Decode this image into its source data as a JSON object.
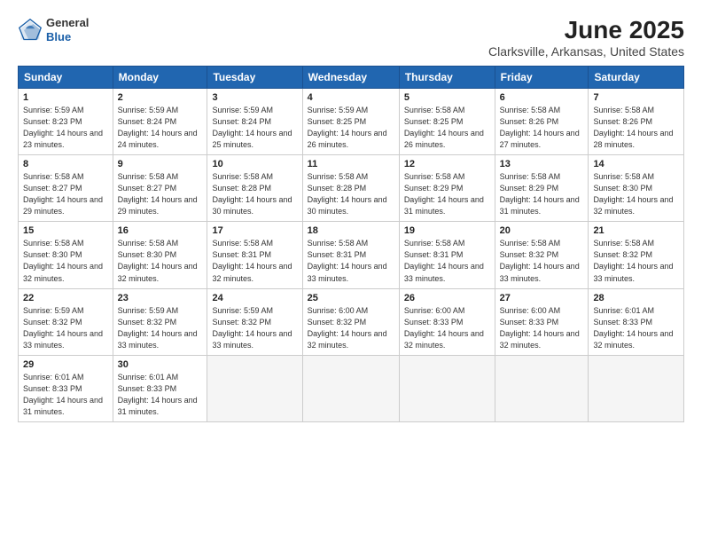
{
  "logo": {
    "general": "General",
    "blue": "Blue"
  },
  "title": "June 2025",
  "subtitle": "Clarksville, Arkansas, United States",
  "days_of_week": [
    "Sunday",
    "Monday",
    "Tuesday",
    "Wednesday",
    "Thursday",
    "Friday",
    "Saturday"
  ],
  "weeks": [
    [
      {
        "day": 1,
        "sunrise": "5:59 AM",
        "sunset": "8:23 PM",
        "daylight": "14 hours and 23 minutes."
      },
      {
        "day": 2,
        "sunrise": "5:59 AM",
        "sunset": "8:24 PM",
        "daylight": "14 hours and 24 minutes."
      },
      {
        "day": 3,
        "sunrise": "5:59 AM",
        "sunset": "8:24 PM",
        "daylight": "14 hours and 25 minutes."
      },
      {
        "day": 4,
        "sunrise": "5:59 AM",
        "sunset": "8:25 PM",
        "daylight": "14 hours and 26 minutes."
      },
      {
        "day": 5,
        "sunrise": "5:58 AM",
        "sunset": "8:25 PM",
        "daylight": "14 hours and 26 minutes."
      },
      {
        "day": 6,
        "sunrise": "5:58 AM",
        "sunset": "8:26 PM",
        "daylight": "14 hours and 27 minutes."
      },
      {
        "day": 7,
        "sunrise": "5:58 AM",
        "sunset": "8:26 PM",
        "daylight": "14 hours and 28 minutes."
      }
    ],
    [
      {
        "day": 8,
        "sunrise": "5:58 AM",
        "sunset": "8:27 PM",
        "daylight": "14 hours and 29 minutes."
      },
      {
        "day": 9,
        "sunrise": "5:58 AM",
        "sunset": "8:27 PM",
        "daylight": "14 hours and 29 minutes."
      },
      {
        "day": 10,
        "sunrise": "5:58 AM",
        "sunset": "8:28 PM",
        "daylight": "14 hours and 30 minutes."
      },
      {
        "day": 11,
        "sunrise": "5:58 AM",
        "sunset": "8:28 PM",
        "daylight": "14 hours and 30 minutes."
      },
      {
        "day": 12,
        "sunrise": "5:58 AM",
        "sunset": "8:29 PM",
        "daylight": "14 hours and 31 minutes."
      },
      {
        "day": 13,
        "sunrise": "5:58 AM",
        "sunset": "8:29 PM",
        "daylight": "14 hours and 31 minutes."
      },
      {
        "day": 14,
        "sunrise": "5:58 AM",
        "sunset": "8:30 PM",
        "daylight": "14 hours and 32 minutes."
      }
    ],
    [
      {
        "day": 15,
        "sunrise": "5:58 AM",
        "sunset": "8:30 PM",
        "daylight": "14 hours and 32 minutes."
      },
      {
        "day": 16,
        "sunrise": "5:58 AM",
        "sunset": "8:30 PM",
        "daylight": "14 hours and 32 minutes."
      },
      {
        "day": 17,
        "sunrise": "5:58 AM",
        "sunset": "8:31 PM",
        "daylight": "14 hours and 32 minutes."
      },
      {
        "day": 18,
        "sunrise": "5:58 AM",
        "sunset": "8:31 PM",
        "daylight": "14 hours and 33 minutes."
      },
      {
        "day": 19,
        "sunrise": "5:58 AM",
        "sunset": "8:31 PM",
        "daylight": "14 hours and 33 minutes."
      },
      {
        "day": 20,
        "sunrise": "5:58 AM",
        "sunset": "8:32 PM",
        "daylight": "14 hours and 33 minutes."
      },
      {
        "day": 21,
        "sunrise": "5:58 AM",
        "sunset": "8:32 PM",
        "daylight": "14 hours and 33 minutes."
      }
    ],
    [
      {
        "day": 22,
        "sunrise": "5:59 AM",
        "sunset": "8:32 PM",
        "daylight": "14 hours and 33 minutes."
      },
      {
        "day": 23,
        "sunrise": "5:59 AM",
        "sunset": "8:32 PM",
        "daylight": "14 hours and 33 minutes."
      },
      {
        "day": 24,
        "sunrise": "5:59 AM",
        "sunset": "8:32 PM",
        "daylight": "14 hours and 33 minutes."
      },
      {
        "day": 25,
        "sunrise": "6:00 AM",
        "sunset": "8:32 PM",
        "daylight": "14 hours and 32 minutes."
      },
      {
        "day": 26,
        "sunrise": "6:00 AM",
        "sunset": "8:33 PM",
        "daylight": "14 hours and 32 minutes."
      },
      {
        "day": 27,
        "sunrise": "6:00 AM",
        "sunset": "8:33 PM",
        "daylight": "14 hours and 32 minutes."
      },
      {
        "day": 28,
        "sunrise": "6:01 AM",
        "sunset": "8:33 PM",
        "daylight": "14 hours and 32 minutes."
      }
    ],
    [
      {
        "day": 29,
        "sunrise": "6:01 AM",
        "sunset": "8:33 PM",
        "daylight": "14 hours and 31 minutes."
      },
      {
        "day": 30,
        "sunrise": "6:01 AM",
        "sunset": "8:33 PM",
        "daylight": "14 hours and 31 minutes."
      },
      null,
      null,
      null,
      null,
      null
    ]
  ]
}
